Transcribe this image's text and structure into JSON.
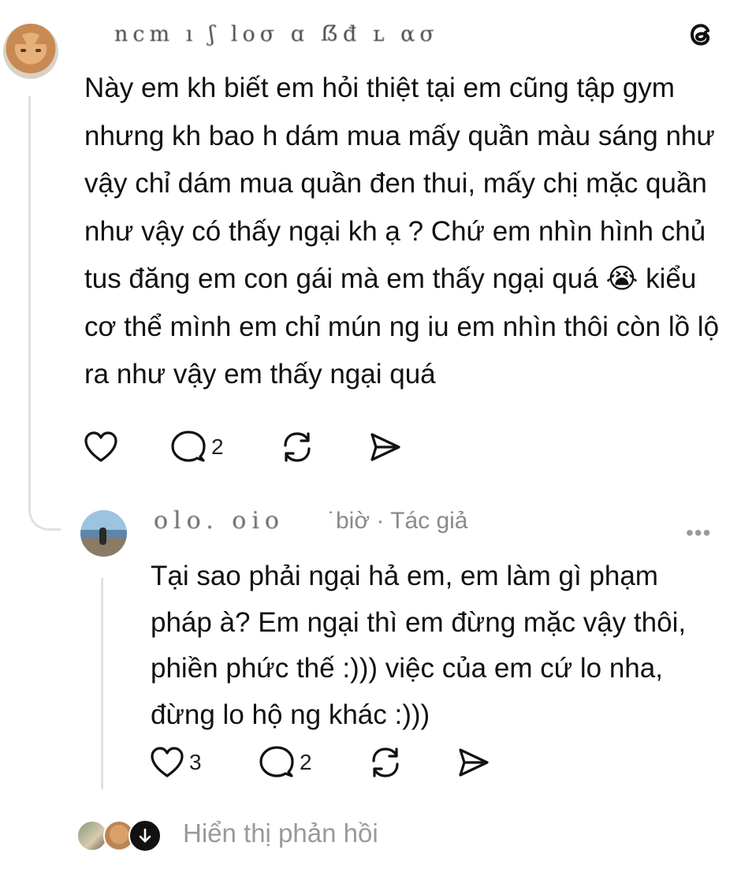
{
  "comment": {
    "username": "ncm ı ʃ loσ  ɑ ẞđ ʟ   ασ",
    "body": "Này em kh biết em hỏi thiệt tại em cũng tập gym nhưng kh bao h dám mua mấy quần màu sáng như vậy chỉ dám mua quần đen thui, mấy chị mặc quần như vậy có thấy ngại kh ạ ? Chứ em nhìn hình chủ tus đăng em con gái mà em thấy ngại quá 😭 kiểu cơ thể mình em chỉ mún ng iu em nhìn thôi còn lồ lộ ra như vậy em thấy ngại quá",
    "likes": "",
    "replies": "2",
    "icons": [
      "heart-icon",
      "comment-icon",
      "repost-icon",
      "share-icon"
    ]
  },
  "reply": {
    "username": "olo.  oio",
    "meta": "˙biờ · Tác giả",
    "more": "•••",
    "body": "Tại sao phải ngại hả em, em làm gì phạm pháp à? Em ngại thì em đừng mặc vậy thôi, phiền phức thế :))) việc của em cứ lo nha, đừng lo hộ ng khác :)))",
    "likes": "3",
    "replies": "2"
  },
  "footer": {
    "show_replies": "Hiển thị phản hồi"
  },
  "colors": {
    "text": "#111111",
    "muted": "#8a8a8a",
    "thread_line": "#e1e1e1",
    "background": "#ffffff"
  }
}
